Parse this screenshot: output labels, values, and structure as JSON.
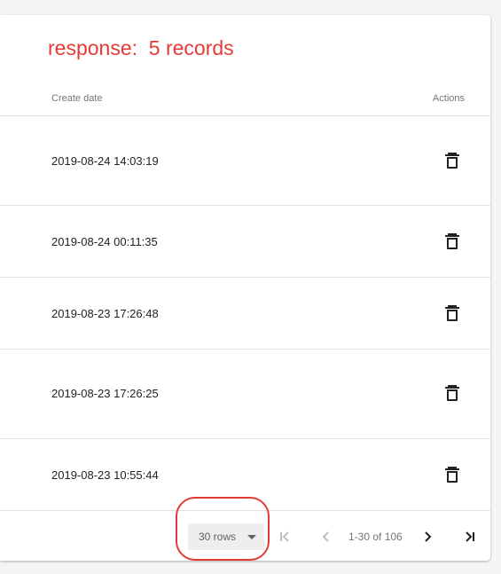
{
  "annotation": {
    "text": "response:  5 records"
  },
  "table": {
    "headers": {
      "create_date": "Create date",
      "actions": "Actions"
    },
    "rows": [
      {
        "create_date": "2019-08-24 14:03:19"
      },
      {
        "create_date": "2019-08-24 00:11:35"
      },
      {
        "create_date": "2019-08-23 17:26:48"
      },
      {
        "create_date": "2019-08-23 17:26:25"
      },
      {
        "create_date": "2019-08-23 10:55:44"
      }
    ]
  },
  "pagination": {
    "rows_per_page": "30 rows",
    "range": "1-30 of 106"
  },
  "colors": {
    "annotation": "#e53935",
    "icon_active": "#212121",
    "icon_disabled": "#bdbdbd"
  },
  "icons": {
    "delete": "trash-icon",
    "first": "first-page-icon",
    "prev": "chevron-left-icon",
    "next": "chevron-right-icon",
    "last": "last-page-icon",
    "dropdown": "caret-down-icon"
  }
}
